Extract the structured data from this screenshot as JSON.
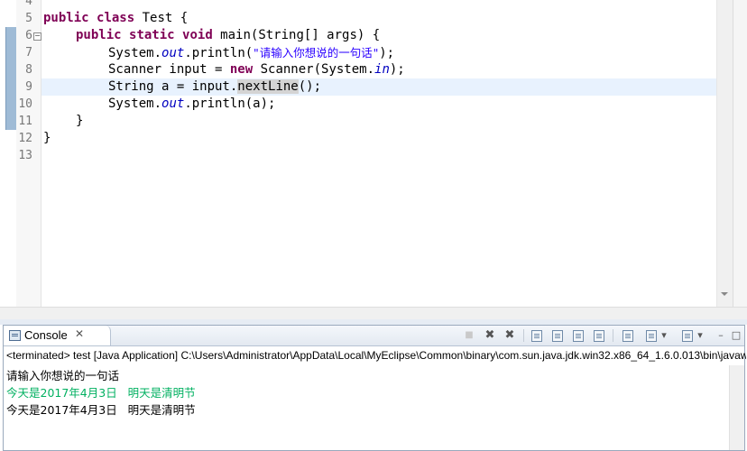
{
  "editor": {
    "line_numbers": [
      "4",
      "5",
      "6",
      "7",
      "8",
      "9",
      "10",
      "11",
      "12",
      "13"
    ],
    "code": {
      "line5": {
        "kw1": "public",
        "kw2": "class",
        "rest": " Test {"
      },
      "line6": {
        "kw1": "public",
        "kw2": "static",
        "kw3": "void",
        "rest": " main(String[] args) {"
      },
      "line7": {
        "a": "System.",
        "fld": "out",
        "b": ".println(",
        "str": "\"请输入你想说的一句话\"",
        "c": ");"
      },
      "line8": {
        "a": "Scanner input = ",
        "kw": "new",
        "b": " Scanner(System.",
        "fld": "in",
        "c": ");"
      },
      "line9": {
        "a": "String a = input.",
        "occ": "nextLine",
        "b": "();"
      },
      "line10": {
        "a": "System.",
        "fld": "out",
        "b": ".println(a);"
      },
      "line11": "}",
      "line12": "}"
    },
    "current_line": "9",
    "colors": {
      "keyword": "#7f0055",
      "field": "#0000c0",
      "string": "#2a00ff",
      "current_line": "#e8f2fe",
      "change_ruler": "#9fbbd6"
    }
  },
  "console": {
    "tab_title": "Console",
    "close_glyph": "✕",
    "status": "<terminated> test [Java Application] C:\\Users\\Administrator\\AppData\\Local\\MyEclipse\\Common\\binary\\com.sun.java.jdk.win32.x86_64_1.6.0.013\\bin\\javaw.exe",
    "output": [
      {
        "text": "请输入你想说的一句话",
        "color": "#000000"
      },
      {
        "text": "今天是2017年4月3日   明天是清明节",
        "color": "#00b060"
      },
      {
        "text": "今天是2017年4月3日   明天是清明节",
        "color": "#000000"
      }
    ],
    "toolbar_icons": [
      "terminate-icon",
      "remove-launch-icon",
      "remove-all-terminated-icon",
      "scroll-lock-icon",
      "show-on-stdout-icon",
      "show-on-stderr-icon",
      "word-wrap-icon",
      "pin-console-icon",
      "display-console-icon",
      "display-dropdown-icon",
      "open-console-icon",
      "open-console-dropdown-icon",
      "minimize-icon",
      "maximize-icon"
    ],
    "glyphs": {
      "terminate": "■",
      "remove": "✖",
      "remove_all": "✖",
      "dropdown": "▾",
      "minimize": "–",
      "maximize": "□",
      "pin": "📌"
    }
  }
}
